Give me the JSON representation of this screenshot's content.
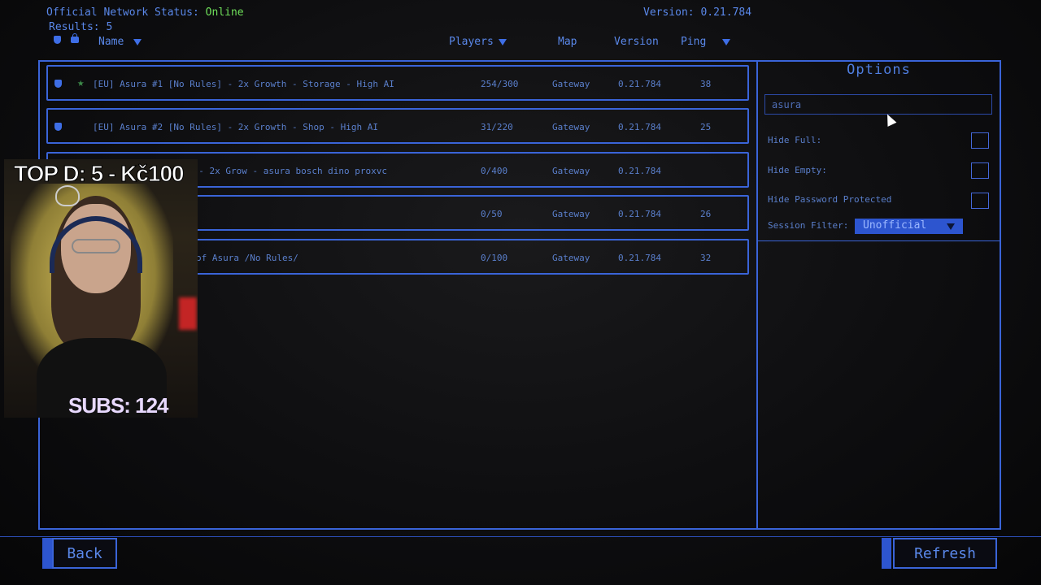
{
  "header": {
    "status_label": "Official Network Status:",
    "status_value": "Online",
    "results": "Results: 5",
    "version": "Version: 0.21.784"
  },
  "columns": {
    "name": "Name",
    "players": "Players",
    "map": "Map",
    "version": "Version",
    "ping": "Ping"
  },
  "servers": [
    {
      "name": "[EU] Asura #1 [No Rules] - 2x Growth - Storage - High AI",
      "players": "254/300",
      "map": "Gateway",
      "version": "0.21.784",
      "ping": "38"
    },
    {
      "name": "[EU] Asura #2 [No Rules] - 2x Growth - Shop - High AI",
      "players": "31/220",
      "map": "Gateway",
      "version": "0.21.784",
      "ping": "25"
    },
    {
      "name": "] - 2x Grow - asura bosch dino proxvc",
      "players": "0/400",
      "map": "Gateway",
      "version": "0.21.784",
      "ping": ""
    },
    {
      "name": "",
      "players": "0/50",
      "map": "Gateway",
      "version": "0.21.784",
      "ping": "26"
    },
    {
      "name": "of Asura /No Rules/",
      "players": "0/100",
      "map": "Gateway",
      "version": "0.21.784",
      "ping": "32"
    }
  ],
  "options": {
    "title": "Options",
    "search_value": "asura",
    "hide_full": "Hide Full:",
    "hide_empty": "Hide Empty:",
    "hide_password": "Hide Password Protected",
    "session_filter_label": "Session Filter:",
    "session_filter_value": "Unofficial"
  },
  "buttons": {
    "back": "Back",
    "refresh": "Refresh"
  },
  "overlay": {
    "top_donation": "TOP D: 5 - Kč100",
    "subs": "SUBS: 124"
  }
}
